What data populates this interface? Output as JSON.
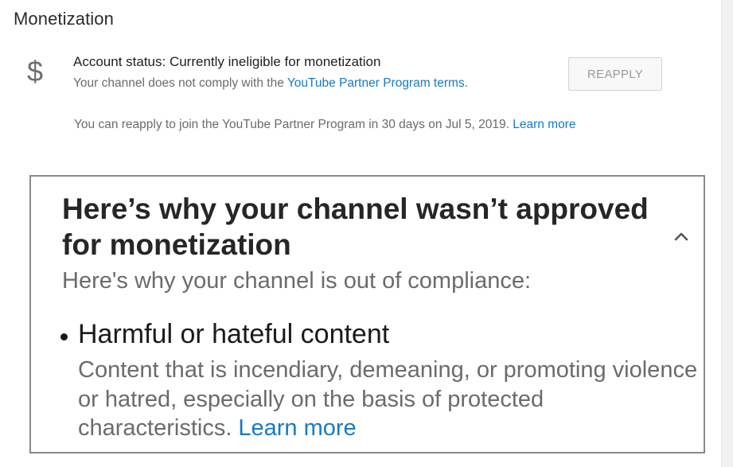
{
  "section": {
    "title": "Monetization"
  },
  "account_status": {
    "icon": "dollar-icon",
    "status_text": "Account status: Currently ineligible for monetization",
    "compliance_prefix": "Your channel does not comply with the ",
    "compliance_link": "YouTube Partner Program terms",
    "compliance_suffix": ".",
    "reapply_button": "REAPPLY",
    "reapply_note": "You can reapply to join the YouTube Partner Program in 30 days on Jul 5, 2019.",
    "learn_more": "Learn more"
  },
  "reason_card": {
    "heading": "Here’s why your channel wasn’t approved for monetization",
    "collapse_icon": "chevron-up-icon",
    "subheading": "Here's why your channel is out of compliance:",
    "reasons": [
      {
        "title": "Harmful or hateful content",
        "description": "Content that is incendiary, demeaning, or promoting violence or hatred, especially on the basis of protected characteristics.",
        "learn_more": "Learn more"
      }
    ]
  },
  "colors": {
    "link": "#167ac6",
    "muted_text": "#6b6b6b",
    "card_border": "#8a8a8a"
  }
}
